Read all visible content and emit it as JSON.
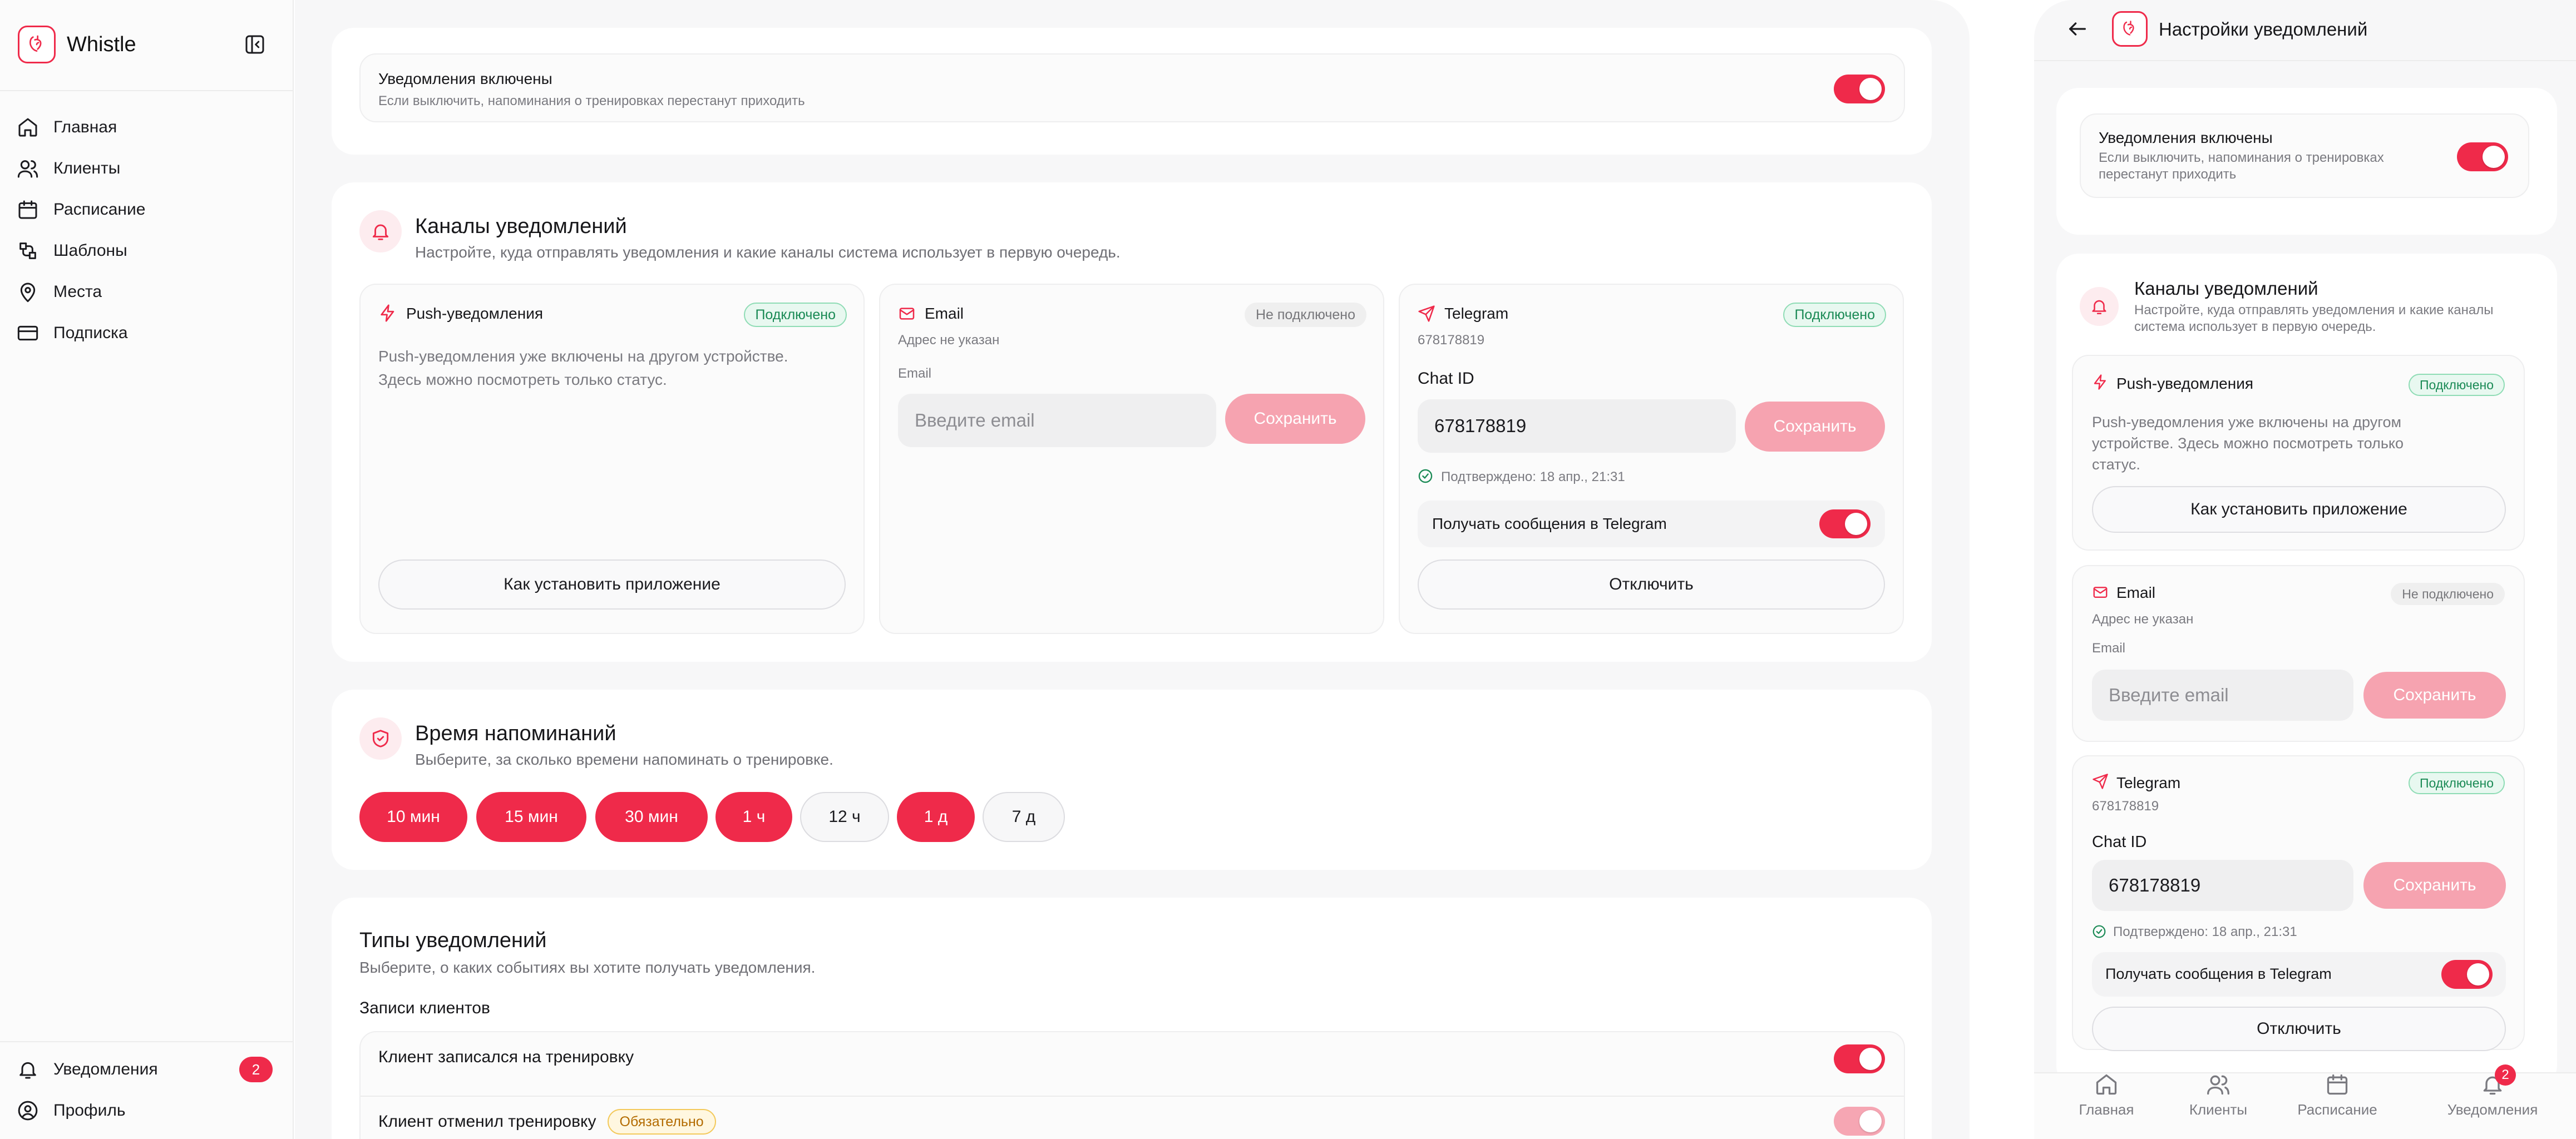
{
  "app": {
    "name": "Whistle"
  },
  "sidebar": {
    "items": [
      {
        "label": "Главная"
      },
      {
        "label": "Клиенты"
      },
      {
        "label": "Расписание"
      },
      {
        "label": "Шаблоны"
      },
      {
        "label": "Места"
      },
      {
        "label": "Подписка"
      }
    ],
    "bottom": {
      "notifications": {
        "label": "Уведомления",
        "badge": "2"
      },
      "profile": {
        "label": "Профиль"
      }
    }
  },
  "main": {
    "enabled": {
      "title": "Уведомления включены",
      "subtitle": "Если выключить, напоминания о тренировках перестанут приходить",
      "state": "on"
    },
    "channels": {
      "title": "Каналы уведомлений",
      "desc": "Настройте, куда отправлять уведомления и какие каналы система использует в первую очередь.",
      "push": {
        "title": "Push-уведомления",
        "status": "Подключено",
        "text": "Push-уведомления уже включены на другом устройстве. Здесь можно посмотреть только статус.",
        "button": "Как установить приложение"
      },
      "email": {
        "title": "Email",
        "status": "Не подключено",
        "address": "Адрес не указан",
        "field_label": "Email",
        "placeholder": "Введите email",
        "save": "Сохранить"
      },
      "telegram": {
        "title": "Telegram",
        "status": "Подключено",
        "id": "678178819",
        "chat_label": "Chat ID",
        "chat_value": "678178819",
        "save": "Сохранить",
        "confirmed": "Подтверждено: 18 апр., 21:31",
        "receive": "Получать сообщения в Telegram",
        "disconnect": "Отключить"
      }
    },
    "reminders": {
      "title": "Время напоминаний",
      "desc": "Выберите, за сколько времени напоминать о тренировке.",
      "chips": [
        {
          "label": "10 мин",
          "selected": true
        },
        {
          "label": "15 мин",
          "selected": true
        },
        {
          "label": "30 мин",
          "selected": true
        },
        {
          "label": "1 ч",
          "selected": true
        },
        {
          "label": "12 ч",
          "selected": false
        },
        {
          "label": "1 д",
          "selected": true
        },
        {
          "label": "7 д",
          "selected": false
        }
      ]
    },
    "types": {
      "title": "Типы уведомлений",
      "desc": "Выберите, о каких событиях вы хотите получать уведомления.",
      "group": "Записи клиентов",
      "rows": [
        {
          "label": "Клиент записался на тренировку",
          "state": "on"
        },
        {
          "label": "Клиент отменил тренировку",
          "badge": "Обязательно",
          "state": "locked"
        }
      ]
    }
  },
  "mobile": {
    "title": "Настройки уведомлений",
    "enabled": {
      "title": "Уведомления включены",
      "subtitle_line1": "Если выключить, напоминания о тренировках",
      "subtitle_line2": "перестанут приходить"
    },
    "channels": {
      "title": "Каналы уведомлений",
      "desc_line1": "Настройте, куда отправлять уведомления и какие каналы",
      "desc_line2": "система использует в первую очередь.",
      "push_text_line1": "Push-уведомления уже включены на другом",
      "push_text_line2": "устройстве. Здесь можно посмотреть только",
      "push_text_line3": "статус."
    },
    "tabs": [
      {
        "label": "Главная"
      },
      {
        "label": "Клиенты"
      },
      {
        "label": "Расписание"
      },
      {
        "label": "Уведомления",
        "badge": "2"
      }
    ]
  },
  "colors": {
    "accent": "#ef2a4a",
    "accent_light": "#f6a3b0",
    "success": "#1a8a55",
    "warning": "#b36b00"
  }
}
